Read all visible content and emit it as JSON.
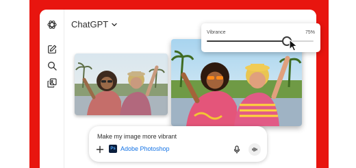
{
  "app": {
    "title": "ChatGPT"
  },
  "sidebar": {
    "items": [
      {
        "icon": "openai-logo-icon"
      },
      {
        "icon": "new-chat-icon"
      },
      {
        "icon": "search-icon"
      },
      {
        "icon": "library-icon"
      }
    ]
  },
  "adjustment": {
    "label": "Vibrance",
    "value_text": "75%",
    "value": 0.75
  },
  "composer": {
    "prompt": "Make my image more vibrant",
    "app_name": "Adobe Photoshop",
    "app_badge": "Ps"
  },
  "colors": {
    "frame": "#e8150f",
    "photoshop_blue": "#1473e6",
    "photoshop_badge": "#0b1e3d"
  }
}
